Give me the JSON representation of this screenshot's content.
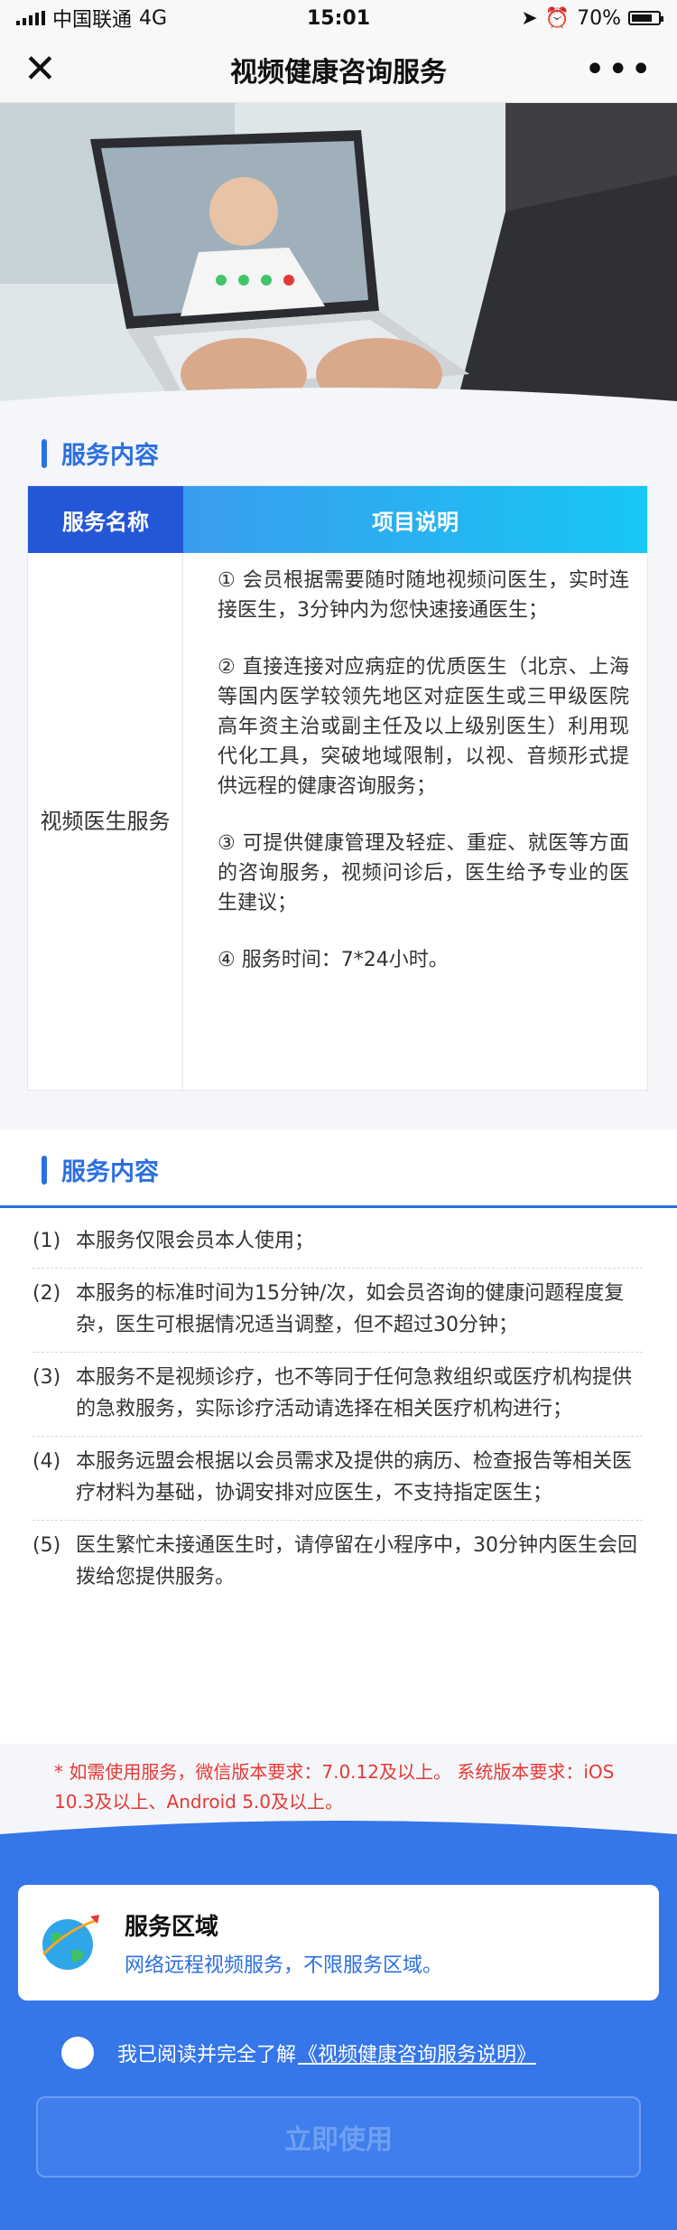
{
  "status_bar": {
    "carrier": "中国联通",
    "network": "4G",
    "time": "15:01",
    "battery": "70%"
  },
  "nav": {
    "title": "视频健康咨询服务",
    "close_label": "✕",
    "more_label": "•••"
  },
  "service_section": {
    "title": "服务内容",
    "table": {
      "header_name": "服务名称",
      "header_desc": "项目说明",
      "service_name": "视频医生服务",
      "items": [
        "① 会员根据需要随时随地视频问医生，实时连接医生，3分钟内为您快速接通医生；",
        "② 直接连接对应病症的优质医生（北京、上海等国内医学较领先地区对症医生或三甲级医院高年资主治或副主任及以上级别医生）利用现代化工具，突破地域限制，以视、音频形式提供远程的健康咨询服务；",
        "③ 可提供健康管理及轻症、重症、就医等方面的咨询服务，视频问诊后，医生给予专业的医生建议；",
        "④ 服务时间：7*24小时。"
      ]
    }
  },
  "notes_section": {
    "title": "服务内容",
    "items": [
      {
        "num": "(1)",
        "text": "本服务仅限会员本人使用；"
      },
      {
        "num": "(2)",
        "text": "本服务的标准时间为15分钟/次，如会员咨询的健康问题程度复杂，医生可根据情况适当调整，但不超过30分钟；"
      },
      {
        "num": "(3)",
        "text": "本服务不是视频诊疗，也不等同于任何急救组织或医疗机构提供的急救服务，实际诊疗活动请选择在相关医疗机构进行；"
      },
      {
        "num": "(4)",
        "text": "本服务远盟会根据以会员需求及提供的病历、检查报告等相关医疗材料为基础，协调安排对应医生，不支持指定医生；"
      },
      {
        "num": "(5)",
        "text": "医生繁忙未接通医生时，请停留在小程序中，30分钟内医生会回拨给您提供服务。"
      }
    ]
  },
  "version_note": "* 如需使用服务，微信版本要求：7.0.12及以上。 系统版本要求：iOS 10.3及以上、Android 5.0及以上。",
  "service_area": {
    "title": "服务区域",
    "desc": "网络远程视频服务，不限服务区域。"
  },
  "agreement": {
    "prefix": "我已阅读并完全了解",
    "link": "《视频健康咨询服务说明》"
  },
  "use_button": "立即使用",
  "colors": {
    "primary": "#3576e8",
    "accent_blue": "#2b6fe0",
    "header_dark": "#2457d8",
    "warning": "#e53935"
  }
}
